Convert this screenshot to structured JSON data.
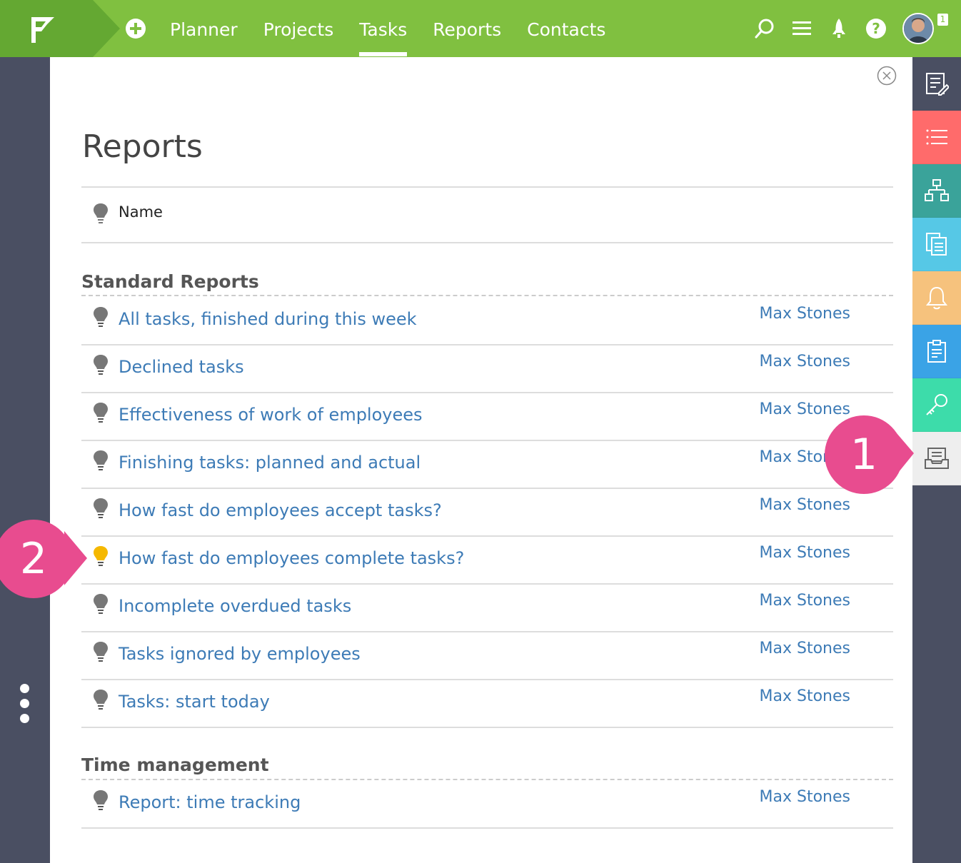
{
  "nav": {
    "items": [
      {
        "label": "Planner",
        "active": false
      },
      {
        "label": "Projects",
        "active": false
      },
      {
        "label": "Tasks",
        "active": true
      },
      {
        "label": "Reports",
        "active": false
      },
      {
        "label": "Contacts",
        "active": false
      }
    ],
    "notification_count": "1"
  },
  "page": {
    "title": "Reports",
    "column_name": "Name"
  },
  "groups": [
    {
      "title": "Standard Reports",
      "rows": [
        {
          "name": "All tasks, finished during this week",
          "owner": "Max Stones",
          "favorite": false
        },
        {
          "name": "Declined tasks",
          "owner": "Max Stones",
          "favorite": false
        },
        {
          "name": "Effectiveness of work of employees",
          "owner": "Max Stones",
          "favorite": false
        },
        {
          "name": "Finishing tasks: planned and actual",
          "owner": "Max Stones",
          "favorite": false
        },
        {
          "name": "How fast do employees accept tasks?",
          "owner": "Max Stones",
          "favorite": false
        },
        {
          "name": "How fast do employees complete tasks?",
          "owner": "Max Stones",
          "favorite": true
        },
        {
          "name": "Incomplete overdued tasks",
          "owner": "Max Stones",
          "favorite": false
        },
        {
          "name": "Tasks ignored by employees",
          "owner": "Max Stones",
          "favorite": false
        },
        {
          "name": "Tasks: start today",
          "owner": "Max Stones",
          "favorite": false
        }
      ]
    },
    {
      "title": "Time management",
      "rows": [
        {
          "name": "Report: time tracking",
          "owner": "Max Stones",
          "favorite": false
        }
      ]
    }
  ],
  "right_rail": [
    {
      "icon": "edit-list-icon",
      "color": "#4a4f62"
    },
    {
      "icon": "list-icon",
      "color": "#ff6b6b"
    },
    {
      "icon": "org-chart-icon",
      "color": "#3aa39a"
    },
    {
      "icon": "documents-icon",
      "color": "#56c8e6"
    },
    {
      "icon": "bell-icon",
      "color": "#f6c27d"
    },
    {
      "icon": "clipboard-icon",
      "color": "#3aa3e6"
    },
    {
      "icon": "key-icon",
      "color": "#3ddcaa"
    },
    {
      "icon": "inbox-icon",
      "color": "#eeeeee"
    }
  ],
  "callouts": [
    "1",
    "2"
  ],
  "colors": {
    "topbar": "#80c040",
    "link": "#3d7bb6",
    "callout": "#e84c8f",
    "favorite_bulb": "#f5b800",
    "bulb": "#777777"
  }
}
